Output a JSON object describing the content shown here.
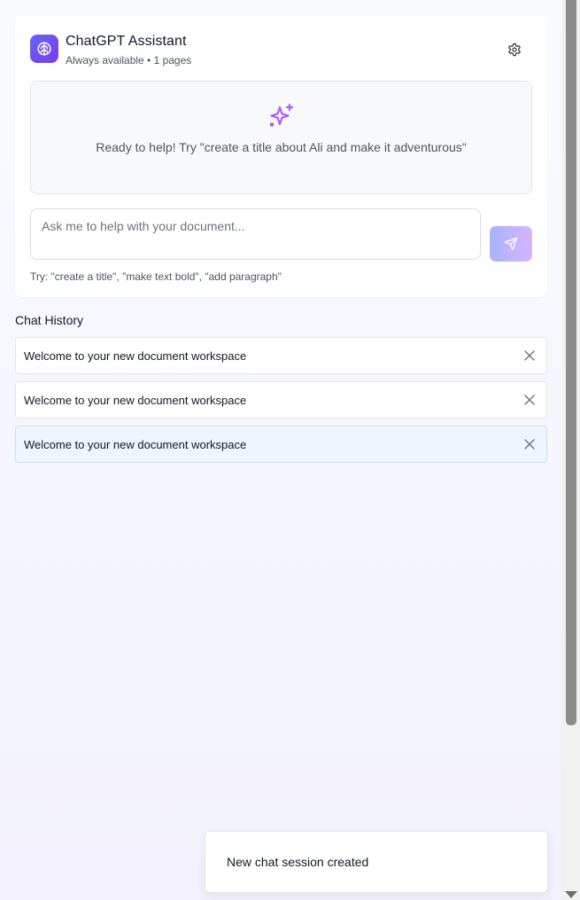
{
  "assistant": {
    "title": "ChatGPT Assistant",
    "subtitle": "Always available • 1 pages",
    "icon": "brain-icon",
    "settings_icon": "gear-icon",
    "accent_color": "#6d5ce7"
  },
  "ready_panel": {
    "icon": "sparkles-icon",
    "text": "Ready to help! Try \"create a title about Ali and make it adventurous\""
  },
  "composer": {
    "placeholder": "Ask me to help with your document...",
    "value": "",
    "send_icon": "send-icon",
    "hint": "Try: \"create a title\", \"make text bold\", \"add paragraph\""
  },
  "history": {
    "title": "Chat History",
    "items": [
      {
        "label": "Welcome to your new document workspace",
        "active": false
      },
      {
        "label": "Welcome to your new document workspace",
        "active": false
      },
      {
        "label": "Welcome to your new document workspace",
        "active": true
      }
    ]
  },
  "toast": {
    "message": "New chat session created"
  }
}
